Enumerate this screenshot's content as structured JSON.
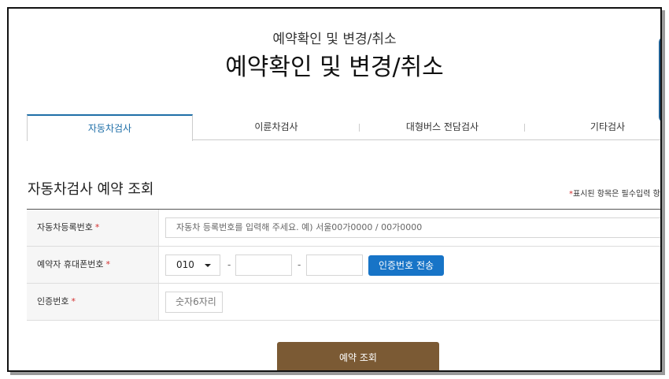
{
  "header": {
    "small_title": "예약확인 및 변경/취소",
    "title": "예약확인 및 변경/취소"
  },
  "tabs": [
    {
      "label": "자동차검사",
      "active": true
    },
    {
      "label": "이륜차검사",
      "active": false
    },
    {
      "label": "대형버스 전담검사",
      "active": false
    },
    {
      "label": "기타검사",
      "active": false
    }
  ],
  "section": {
    "title": "자동차검사 예약 조회",
    "required_star": "*",
    "required_note": "표시된 항목은 필수입력 항"
  },
  "form": {
    "required_star": "*",
    "registration": {
      "label": "자동차등록번호",
      "placeholder": "자동차 등록번호를 입력해 주세요. 예) 서울00가0000 / 00가0000"
    },
    "phone": {
      "label": "예약자 휴대폰번호",
      "prefix": "010",
      "separator": "-",
      "send_button": "인증번호 전송"
    },
    "auth": {
      "label": "인증번호",
      "placeholder": "숫자6자리"
    }
  },
  "submit_button": "예약 조회",
  "colors": {
    "tab_active": "#1f6fa8",
    "send_button": "#1774c7",
    "submit_button": "#7b5a34",
    "required": "#d32f2f"
  }
}
